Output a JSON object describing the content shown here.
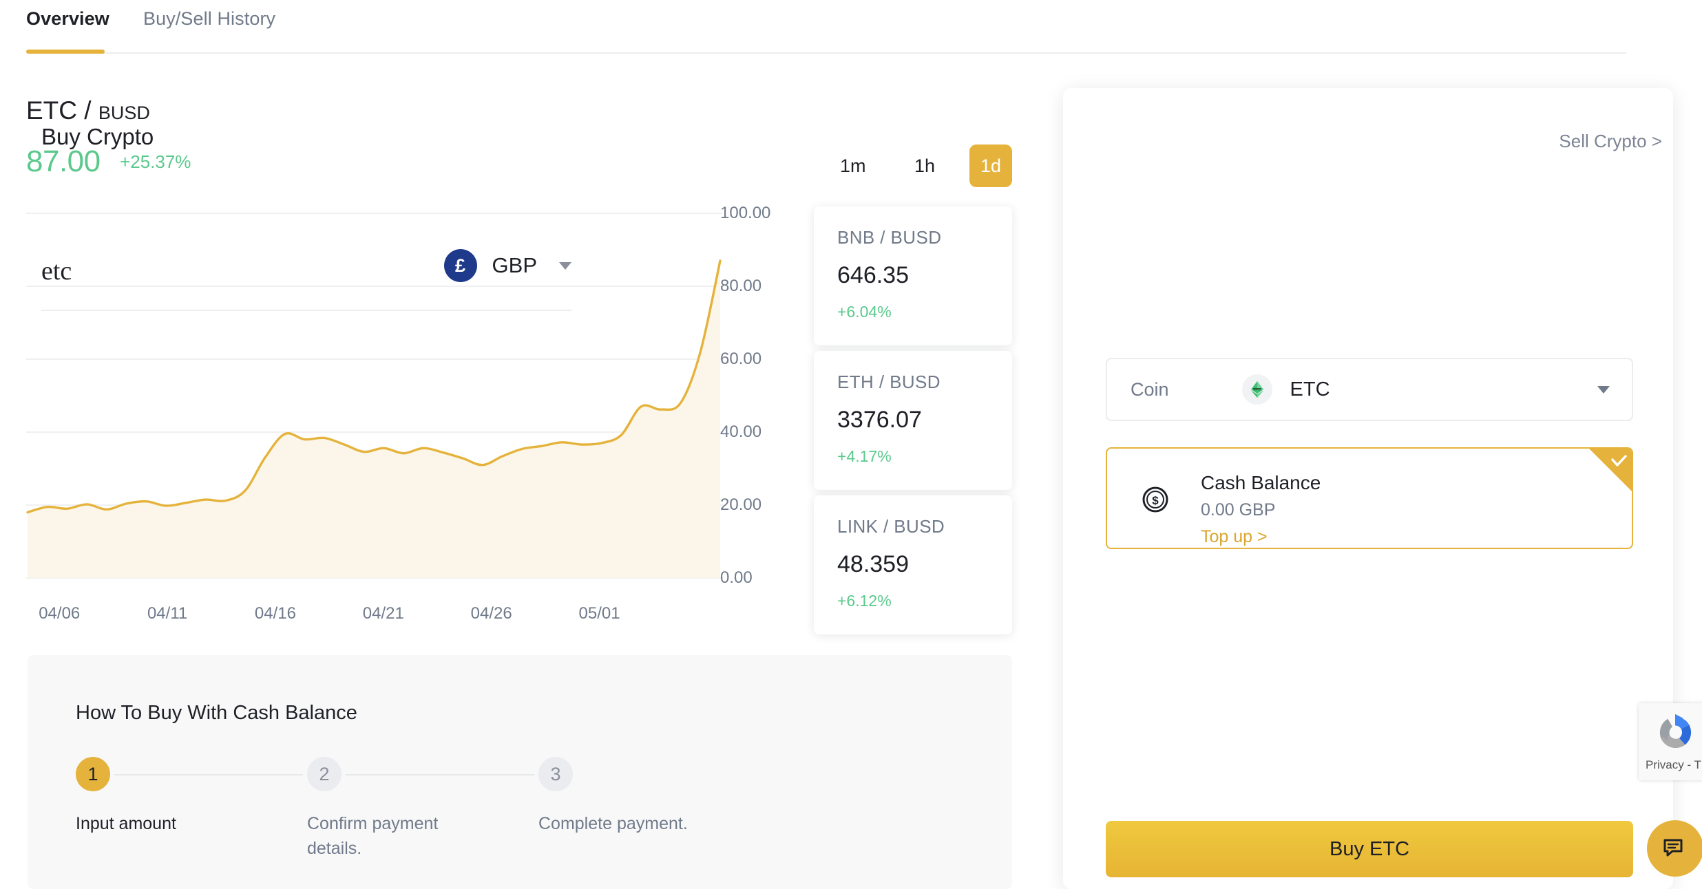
{
  "tabs": [
    {
      "label": "Overview",
      "active": true
    },
    {
      "label": "Buy/Sell History",
      "active": false
    }
  ],
  "pair": {
    "base": "ETC",
    "separator": "/",
    "quote": "BUSD",
    "price": "87.00",
    "change": "+25.37%"
  },
  "timeframes": [
    {
      "label": "1m",
      "active": false
    },
    {
      "label": "1h",
      "active": false
    },
    {
      "label": "1d",
      "active": true
    }
  ],
  "chart_data": {
    "type": "area",
    "title": "",
    "xlabel": "",
    "ylabel": "",
    "grid": true,
    "legend": "none",
    "line_color": "#E5B33C",
    "fill_color": "#FBF6E9",
    "ylim": [
      0,
      100
    ],
    "yticks": [
      "0.00",
      "20.00",
      "40.00",
      "60.00",
      "80.00",
      "100.00"
    ],
    "ytick_values": [
      0,
      20,
      40,
      60,
      80,
      100
    ],
    "xticks": [
      "04/06",
      "04/11",
      "04/16",
      "04/21",
      "04/26",
      "05/01"
    ],
    "xtick_positions": [
      0.02,
      0.175,
      0.33,
      0.485,
      0.64,
      0.795
    ],
    "x": [
      "04/05",
      "04/06",
      "04/07",
      "04/08",
      "04/09",
      "04/10",
      "04/11",
      "04/12",
      "04/13",
      "04/14",
      "04/15",
      "04/16",
      "04/17",
      "04/18",
      "04/19",
      "04/20",
      "04/21",
      "04/22",
      "04/23",
      "04/24",
      "04/25",
      "04/26",
      "04/27",
      "04/28",
      "04/29",
      "04/30",
      "05/01",
      "05/02",
      "05/03",
      "05/04",
      "05/05"
    ],
    "values": [
      18.0,
      19.5,
      19.0,
      20.2,
      18.8,
      20.4,
      21.0,
      19.8,
      20.6,
      21.5,
      21.2,
      24.0,
      33.0,
      39.5,
      38.0,
      38.4,
      36.6,
      34.6,
      35.6,
      34.2,
      35.6,
      34.4,
      32.8,
      31.0,
      33.4,
      35.4,
      36.2,
      37.2,
      36.6,
      37.0,
      39.2
    ],
    "tail_x": [
      "05/06",
      "05/07",
      "05/08",
      "05/09",
      "05/10"
    ],
    "tail_values": [
      47.0,
      46.2,
      48.0,
      62.0,
      87.0
    ]
  },
  "tickers": [
    {
      "pair": "BNB / BUSD",
      "price": "646.35",
      "change": "+6.04%"
    },
    {
      "pair": "ETH / BUSD",
      "price": "3376.07",
      "change": "+4.17%"
    },
    {
      "pair": "LINK / BUSD",
      "price": "48.359",
      "change": "+6.12%"
    }
  ],
  "howto": {
    "title": "How To Buy With Cash Balance",
    "steps": [
      {
        "number": "1",
        "label": "Input amount",
        "active": true
      },
      {
        "number": "2",
        "label": "Confirm payment details.",
        "active": false
      },
      {
        "number": "3",
        "label": "Complete payment.",
        "active": false
      }
    ]
  },
  "buy_panel": {
    "title": "Buy Crypto",
    "sell_link": "Sell Crypto >",
    "amount_value": "etc",
    "amount_placeholder": "",
    "currency_symbol": "£",
    "currency_code": "GBP",
    "coin_label": "Coin",
    "coin_code": "ETC",
    "payment": {
      "name": "Cash Balance",
      "amount": "0.00 GBP",
      "topup": "Top up >",
      "selected": true
    },
    "submit_label": "Buy ETC"
  },
  "widgets": {
    "recaptcha_text": "Privacy - T",
    "chat_icon": "chat-bubble-icon"
  },
  "colors": {
    "accent": "#E5B33C",
    "positive": "#5BC98C",
    "text": "#1E2026",
    "muted": "#707A8A"
  }
}
